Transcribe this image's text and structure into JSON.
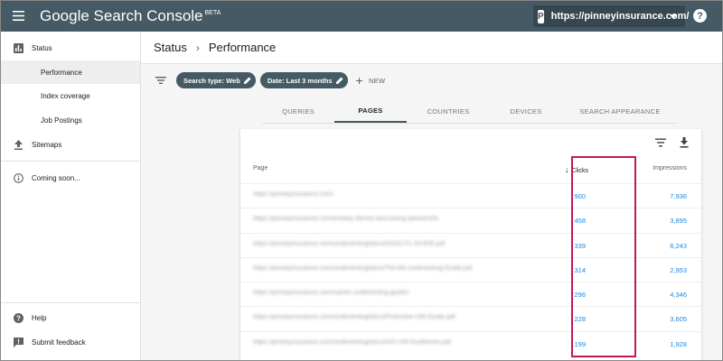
{
  "topbar": {
    "title": "Google Search Console",
    "title_badge": "BETA",
    "property_url": "https://pinneyinsurance.com/",
    "property_icon_letter": "P",
    "help_glyph": "?"
  },
  "sidebar": {
    "items": [
      {
        "label": "Status",
        "icon": "bar-chart-icon"
      },
      {
        "label": "Performance",
        "icon": ""
      },
      {
        "label": "Index coverage",
        "icon": ""
      },
      {
        "label": "Job Postings",
        "icon": ""
      },
      {
        "label": "Sitemaps",
        "icon": "upload-icon"
      },
      {
        "label": "Coming soon...",
        "icon": "info-icon"
      },
      {
        "label": "Help",
        "icon": "help-icon"
      },
      {
        "label": "Submit feedback",
        "icon": "feedback-icon"
      }
    ]
  },
  "header": {
    "crumb_parent": "Status",
    "crumb_sep": "›",
    "crumb_current": "Performance"
  },
  "filters": {
    "chips": [
      {
        "label": "Search type: Web"
      },
      {
        "label": "Date: Last 3 months"
      }
    ],
    "new_label": "NEW",
    "new_plus": "+"
  },
  "tabs": [
    {
      "label": "QUERIES"
    },
    {
      "label": "PAGES"
    },
    {
      "label": "COUNTRIES"
    },
    {
      "label": "DEVICES"
    },
    {
      "label": "SEARCH APPEARANCE"
    }
  ],
  "table": {
    "col_page": "Page",
    "col_clicks": "Clicks",
    "col_impressions": "Impressions",
    "sort_arrow": "↓",
    "rows": [
      {
        "page": "https://pinneyinsurance.com/",
        "clicks": "900",
        "impressions": "7,936"
      },
      {
        "page": "https://pinneyinsurance.com/lindsey-dennis-discussing-advisors/to",
        "clicks": "458",
        "impressions": "3,895"
      },
      {
        "page": "https://pinneyinsurance.com/underwriting/docs/2022/LTC-GUIDE.pdf",
        "clicks": "339",
        "impressions": "6,243"
      },
      {
        "page": "https://pinneyinsurance.com/underwriting/docs/The-life-underwriting-Guide.pdf",
        "clicks": "314",
        "impressions": "2,953"
      },
      {
        "page": "https://pinneyinsurance.com/carrier-underwriting-guides",
        "clicks": "296",
        "impressions": "4,346"
      },
      {
        "page": "https://pinneyinsurance.com/underwriting/docs/Protective-UW-Guide.pdf",
        "clicks": "228",
        "impressions": "3,605"
      },
      {
        "page": "https://pinneyinsurance.com/underwriting/docs/AIG-UW-Guidelines.pdf",
        "clicks": "199",
        "impressions": "1,928"
      }
    ]
  },
  "colors": {
    "topbar": "#455a64",
    "link_blue": "#1e88e5",
    "highlight": "#c2185b"
  }
}
